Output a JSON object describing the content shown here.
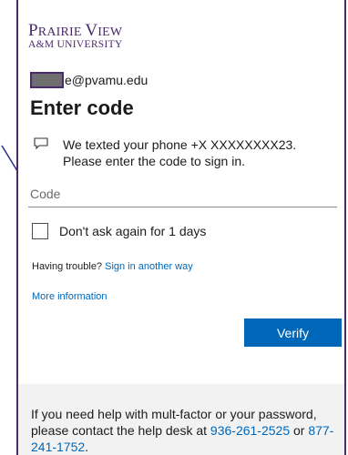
{
  "brand": {
    "line1_prefix": "P",
    "line1_rest": "RAIRIE ",
    "line1_prefix2": "V",
    "line1_rest2": "IEW",
    "line2": "A&M UNIVERSITY"
  },
  "account": {
    "email_visible": "e@pvamu.edu"
  },
  "title": "Enter code",
  "message": {
    "icon": "message-icon",
    "text": "We texted your phone +X XXXXXXXX23. Please enter the code to sign in."
  },
  "code_field": {
    "placeholder": "Code",
    "value": ""
  },
  "remember": {
    "label": "Don't ask again for 1 days",
    "checked": false
  },
  "trouble": {
    "prefix": "Having trouble? ",
    "link": "Sign in another way"
  },
  "more_info": "More information",
  "verify_button": "Verify",
  "help": {
    "text": "If you need help with mult-factor or your password, please contact the help desk at ",
    "phone1": "936-261-2525",
    "or": " or ",
    "phone2": "877-241-1752",
    "end": "."
  },
  "colors": {
    "accent": "#0067b8",
    "brand_purple": "#4b2a6b",
    "footer_bg": "#f2f2f2"
  }
}
